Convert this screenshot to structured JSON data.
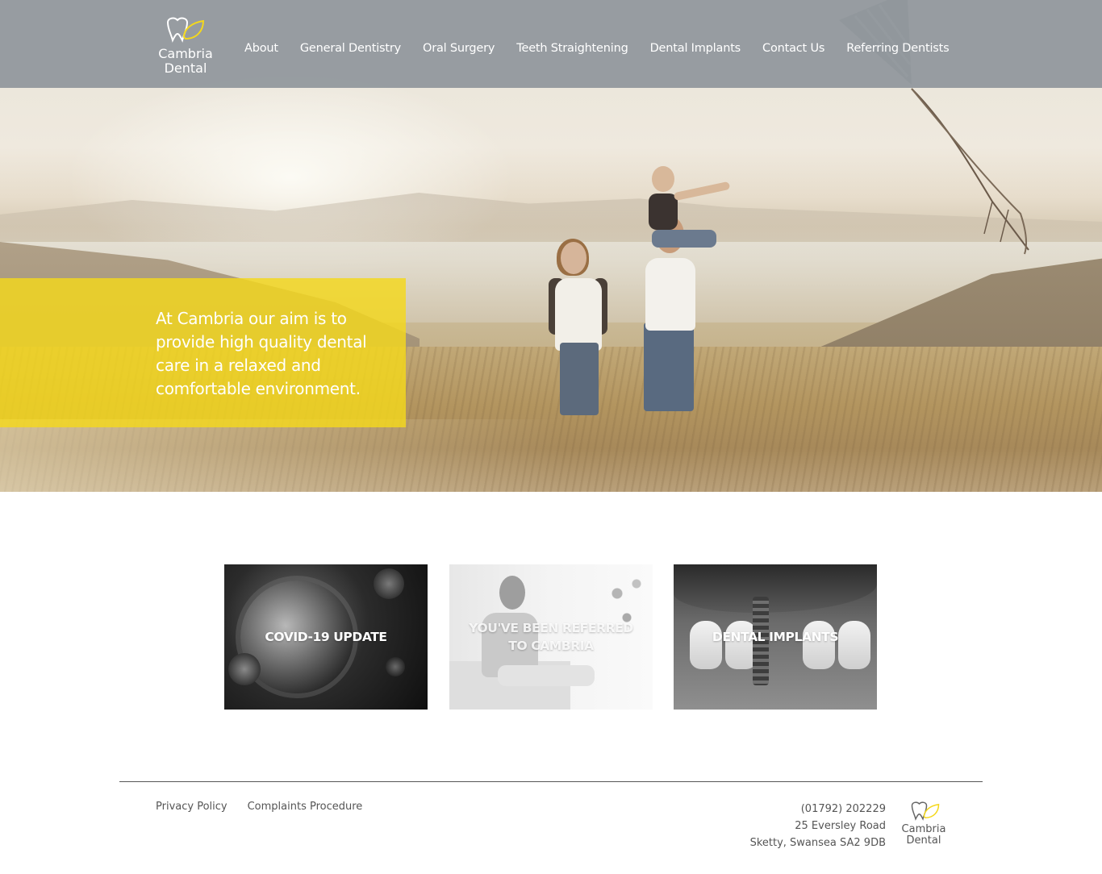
{
  "brand": {
    "name_line1": "Cambria",
    "name_line2": "Dental",
    "logo_icon": "tooth-leaf-icon",
    "accent_color": "#f4d81c"
  },
  "nav": {
    "items": [
      {
        "label": "About"
      },
      {
        "label": "General Dentistry"
      },
      {
        "label": "Oral Surgery"
      },
      {
        "label": "Teeth Straightening"
      },
      {
        "label": "Dental Implants"
      },
      {
        "label": "Contact Us"
      },
      {
        "label": "Referring Dentists"
      }
    ]
  },
  "hero": {
    "tagline": "At Cambria our aim is to provide high quality dental care in a relaxed and comfortable environment."
  },
  "cards": [
    {
      "label": "COVID-19 UPDATE"
    },
    {
      "label": "YOU'VE BEEN REFERRED TO CAMBRIA"
    },
    {
      "label": "DENTAL IMPLANTS"
    }
  ],
  "footer": {
    "links": [
      {
        "label": "Privacy Policy"
      },
      {
        "label": "Complaints Procedure"
      }
    ],
    "phone": "(01792) 202229",
    "address_line1": "25 Eversley Road",
    "address_line2": "Sketty, Swansea SA2 9DB",
    "logo_line1": "Cambria",
    "logo_line2": "Dental"
  }
}
